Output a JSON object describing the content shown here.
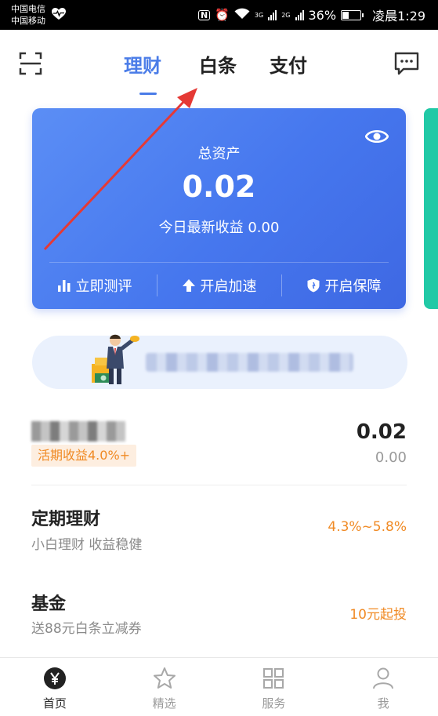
{
  "status_bar": {
    "carrier_1": "中国电信",
    "carrier_2": "中国移动",
    "network_1": "3G",
    "network_2": "2G",
    "battery": "36%",
    "battery_level": 0.36,
    "time": "凌晨1:29",
    "icons": [
      "heart-pulse-icon",
      "nfc-icon",
      "alarm-icon",
      "wifi-icon",
      "signal-icon",
      "battery-icon"
    ]
  },
  "header": {
    "tabs": [
      {
        "label": "理财",
        "active": true
      },
      {
        "label": "白条",
        "active": false
      },
      {
        "label": "支付",
        "active": false
      }
    ],
    "left_icon": "scan-icon",
    "right_icon": "message-icon",
    "accent_color": "#4a7ce8"
  },
  "asset_card": {
    "label": "总资产",
    "value": "0.02",
    "today_label": "今日最新收益 0.00",
    "actions": [
      {
        "label": "立即测评",
        "icon": "bar-chart-icon"
      },
      {
        "label": "开启加速",
        "icon": "arrow-up-icon"
      },
      {
        "label": "开启保障",
        "icon": "shield-icon"
      }
    ],
    "eye_icon": "eye-icon"
  },
  "balance_row": {
    "tag": "活期收益4.0%+",
    "amount": "0.02",
    "sub_amount": "0.00"
  },
  "list": [
    {
      "title": "定期理财",
      "subtitle": "小白理财 收益稳健",
      "right": "4.3%~5.8%"
    },
    {
      "title": "基金",
      "subtitle": "送88元白条立减券",
      "right": "10元起投"
    }
  ],
  "bottom_nav": [
    {
      "label": "首页",
      "icon": "yen-icon",
      "active": true
    },
    {
      "label": "精选",
      "icon": "star-icon",
      "active": false
    },
    {
      "label": "服务",
      "icon": "grid-icon",
      "active": false
    },
    {
      "label": "我",
      "icon": "user-icon",
      "active": false
    }
  ],
  "colors": {
    "orange": "#f08a24",
    "card_gradient_start": "#5b8ef5",
    "card_gradient_end": "#3e68e3",
    "peek_card": "#21c9a6",
    "annotation_arrow": "#e53935"
  }
}
